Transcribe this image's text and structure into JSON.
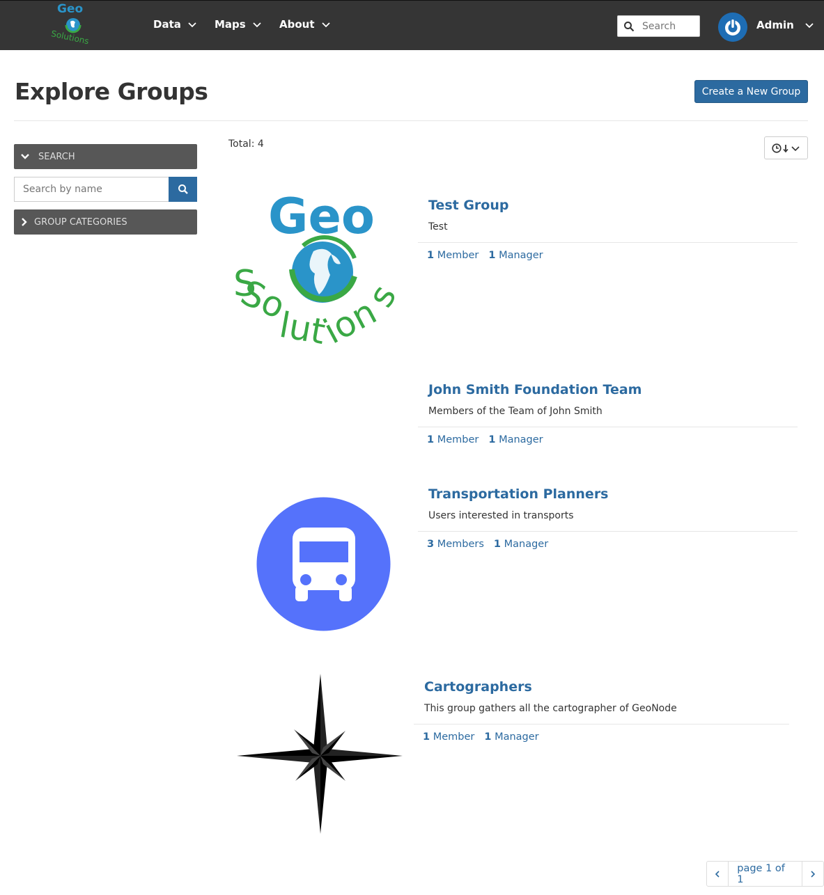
{
  "navbar": {
    "logo_top": "Geo",
    "logo_bottom": "Solutions",
    "menu": [
      {
        "label": "Data"
      },
      {
        "label": "Maps"
      },
      {
        "label": "About"
      }
    ],
    "search_placeholder": "Search",
    "user": {
      "name": "Admin"
    }
  },
  "header": {
    "title": "Explore Groups",
    "create_button": "Create a New Group"
  },
  "sidebar": {
    "search_panel": "SEARCH",
    "search_placeholder": "Search by name",
    "categories_panel": "GROUP CATEGORIES"
  },
  "results": {
    "total_label": "Total: 4",
    "groups": [
      {
        "title": "Test Group",
        "description": "Test",
        "members_count": "1",
        "members_label": "Member",
        "managers_count": "1",
        "managers_label": "Manager",
        "image": "geosolutions-logo"
      },
      {
        "title": "John Smith Foundation Team",
        "description": "Members of the Team of John Smith",
        "members_count": "1",
        "members_label": "Member",
        "managers_count": "1",
        "managers_label": "Manager",
        "image": ""
      },
      {
        "title": "Transportation Planners",
        "description": "Users interested in transports",
        "members_count": "3",
        "members_label": "Members",
        "managers_count": "1",
        "managers_label": "Manager",
        "image": "bus-icon"
      },
      {
        "title": "Cartographers",
        "description": "This group gathers all the cartographer of GeoNode",
        "members_count": "1",
        "members_label": "Member",
        "managers_count": "1",
        "managers_label": "Manager",
        "image": "compass-rose"
      }
    ]
  },
  "pagination": {
    "label": "page 1 of 1"
  },
  "colors": {
    "navbar": "#353535",
    "accent": "#2c6aa0",
    "bus": "#5572fb"
  }
}
